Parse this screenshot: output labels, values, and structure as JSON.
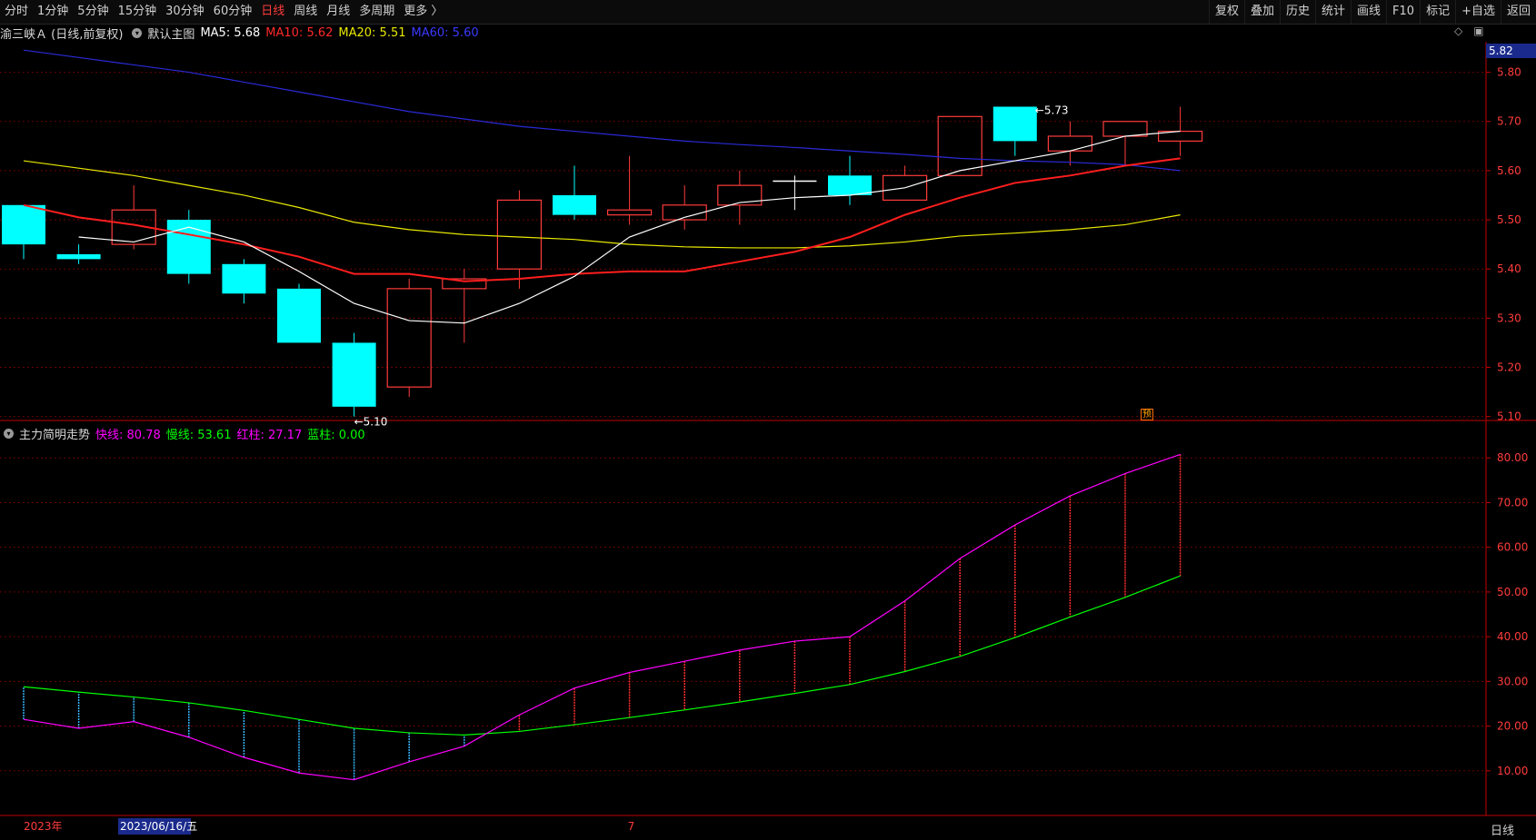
{
  "toolbar": {
    "periods": [
      {
        "label": "分时",
        "active": false
      },
      {
        "label": "1分钟",
        "active": false
      },
      {
        "label": "5分钟",
        "active": false
      },
      {
        "label": "15分钟",
        "active": false
      },
      {
        "label": "30分钟",
        "active": false
      },
      {
        "label": "60分钟",
        "active": false
      },
      {
        "label": "日线",
        "active": true
      },
      {
        "label": "周线",
        "active": false
      },
      {
        "label": "月线",
        "active": false
      },
      {
        "label": "多周期",
        "active": false
      },
      {
        "label": "更多 〉",
        "active": false
      }
    ],
    "actions": [
      "复权",
      "叠加",
      "历史",
      "统计",
      "画线",
      "F10",
      "标记",
      "+自选",
      "返回"
    ]
  },
  "info": {
    "stock": "渝三峡Ａ (日线,前复权)",
    "chart_name": "默认主图",
    "ma5": "MA5: 5.68",
    "ma10": "MA10: 5.62",
    "ma20": "MA20: 5.51",
    "ma60": "MA60: 5.60"
  },
  "indicator": {
    "name": "主力简明走势",
    "fast": "快线: 80.78",
    "slow": "慢线: 53.61",
    "red": "红柱: 27.17",
    "blue": "蓝柱: 0.00"
  },
  "right_icons": {
    "diamond": "◇",
    "square": "▣"
  },
  "price_tag": "5.82",
  "yu_tag": "预",
  "bottom_right_label": "日线",
  "colors": {
    "up": "#ff3b3b",
    "down": "#00ffff",
    "ma5": "#ffffff",
    "ma10": "#ff1e1e",
    "ma20": "#e8e800",
    "ma60": "#2a2ad8",
    "fast": "#ff00ff",
    "slow": "#00ff00",
    "grid": "#6b0000",
    "axis": "#c00000"
  },
  "chart_data": [
    {
      "type": "candlestick",
      "y_ticks": [
        "5.80",
        "5.70",
        "5.60",
        "5.50",
        "5.40",
        "5.30",
        "5.20",
        "5.10"
      ],
      "ylim": [
        5.092,
        5.862
      ],
      "candles": [
        {
          "o": 5.53,
          "h": 5.53,
          "l": 5.42,
          "c": 5.45
        },
        {
          "o": 5.43,
          "h": 5.45,
          "l": 5.41,
          "c": 5.42
        },
        {
          "o": 5.45,
          "h": 5.57,
          "l": 5.44,
          "c": 5.52
        },
        {
          "o": 5.5,
          "h": 5.52,
          "l": 5.37,
          "c": 5.39
        },
        {
          "o": 5.41,
          "h": 5.42,
          "l": 5.33,
          "c": 5.35
        },
        {
          "o": 5.36,
          "h": 5.37,
          "l": 5.25,
          "c": 5.25
        },
        {
          "o": 5.25,
          "h": 5.27,
          "l": 5.1,
          "c": 5.12
        },
        {
          "o": 5.16,
          "h": 5.38,
          "l": 5.14,
          "c": 5.36
        },
        {
          "o": 5.36,
          "h": 5.4,
          "l": 5.25,
          "c": 5.38
        },
        {
          "o": 5.4,
          "h": 5.56,
          "l": 5.36,
          "c": 5.54
        },
        {
          "o": 5.55,
          "h": 5.61,
          "l": 5.5,
          "c": 5.51
        },
        {
          "o": 5.51,
          "h": 5.63,
          "l": 5.49,
          "c": 5.52
        },
        {
          "o": 5.5,
          "h": 5.57,
          "l": 5.48,
          "c": 5.53
        },
        {
          "o": 5.53,
          "h": 5.6,
          "l": 5.49,
          "c": 5.57
        },
        {
          "o": 5.58,
          "h": 5.59,
          "l": 5.52,
          "c": 5.58
        },
        {
          "o": 5.59,
          "h": 5.63,
          "l": 5.53,
          "c": 5.55
        },
        {
          "o": 5.54,
          "h": 5.61,
          "l": 5.54,
          "c": 5.59
        },
        {
          "o": 5.59,
          "h": 5.71,
          "l": 5.59,
          "c": 5.71
        },
        {
          "o": 5.73,
          "h": 5.73,
          "l": 5.63,
          "c": 5.66
        },
        {
          "o": 5.64,
          "h": 5.7,
          "l": 5.61,
          "c": 5.67
        },
        {
          "o": 5.67,
          "h": 5.7,
          "l": 5.61,
          "c": 5.7
        },
        {
          "o": 5.66,
          "h": 5.73,
          "l": 5.63,
          "c": 5.68
        }
      ],
      "ma5": [
        5.465,
        5.455,
        5.485,
        5.455,
        5.395,
        5.33,
        5.295,
        5.29,
        5.33,
        5.385,
        5.465,
        5.505,
        5.535,
        5.545,
        5.55,
        5.565,
        5.6,
        5.62,
        5.64,
        5.67,
        5.68
      ],
      "ma10": [
        5.53,
        5.505,
        5.49,
        5.47,
        5.45,
        5.425,
        5.39,
        5.39,
        5.375,
        5.38,
        5.39,
        5.395,
        5.395,
        5.415,
        5.435,
        5.465,
        5.51,
        5.545,
        5.575,
        5.59,
        5.61,
        5.625
      ],
      "ma20": [
        5.62,
        5.605,
        5.59,
        5.57,
        5.55,
        5.525,
        5.495,
        5.48,
        5.47,
        5.465,
        5.46,
        5.45,
        5.445,
        5.443,
        5.443,
        5.447,
        5.455,
        5.467,
        5.473,
        5.48,
        5.49,
        5.51
      ],
      "ma60": [
        5.845,
        5.83,
        5.815,
        5.8,
        5.78,
        5.76,
        5.74,
        5.72,
        5.705,
        5.69,
        5.68,
        5.67,
        5.66,
        5.653,
        5.647,
        5.64,
        5.633,
        5.625,
        5.62,
        5.617,
        5.612,
        5.6
      ],
      "annotations": [
        {
          "label": "5.73",
          "candle": 18,
          "price": 5.73
        },
        {
          "label": "5.10",
          "candle": 6,
          "price": 5.1
        }
      ]
    },
    {
      "type": "line",
      "y_ticks": [
        "80.00",
        "70.00",
        "60.00",
        "50.00",
        "40.00",
        "30.00",
        "20.00",
        "10.00"
      ],
      "ylim": [
        0,
        83.5
      ],
      "series": [
        {
          "name": "快线",
          "values": [
            21.5,
            19.5,
            21.0,
            17.5,
            13.0,
            9.5,
            8.0,
            12.0,
            15.5,
            22.5,
            28.5,
            32.0,
            34.5,
            37.0,
            39.0,
            40.0,
            48.0,
            57.5,
            65.0,
            71.5,
            76.5,
            80.78
          ]
        },
        {
          "name": "慢线",
          "values": [
            28.8,
            27.6,
            26.5,
            25.2,
            23.5,
            21.5,
            19.5,
            18.5,
            18.0,
            18.8,
            20.3,
            21.9,
            23.6,
            25.4,
            27.3,
            29.3,
            32.2,
            35.6,
            39.8,
            44.4,
            48.8,
            53.61
          ]
        }
      ]
    }
  ],
  "x_labels": [
    {
      "label": "2023年",
      "candle": 0
    },
    {
      "label": "2023/06/16/五",
      "candle": 3
    },
    {
      "label": "7",
      "candle": 11
    }
  ]
}
